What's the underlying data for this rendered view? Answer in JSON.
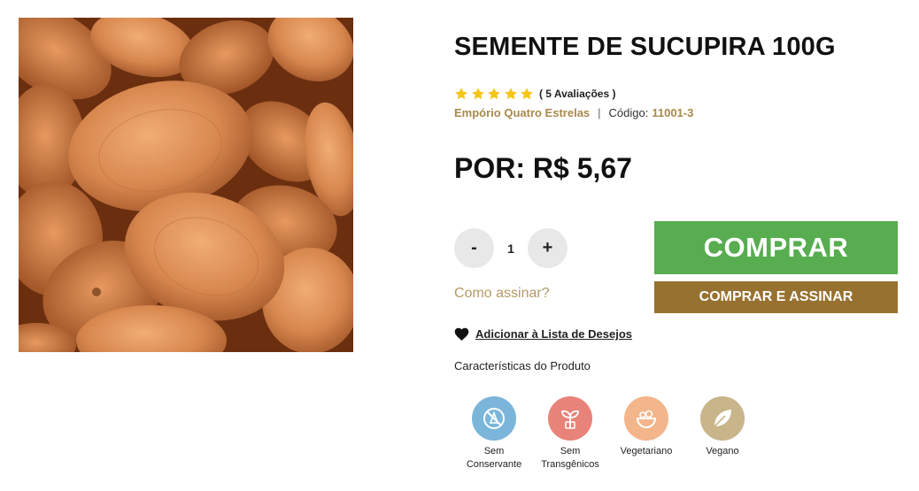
{
  "product": {
    "image_alt": "Semente de Sucupira",
    "title": "SEMENTE DE SUCUPIRA 100G",
    "rating": 5,
    "rating_count_text": "( 5 Avaliações )",
    "brand": "Empório Quatro Estrelas",
    "code_label": "Código:",
    "code_value": "11001-3",
    "price_text": "POR: R$ 5,67"
  },
  "quantity": {
    "decrease_label": "-",
    "value": "1",
    "increase_label": "+"
  },
  "actions": {
    "buy_label": "COMPRAR",
    "subscribe_label": "COMPRAR E ASSINAR",
    "how_to_subscribe": "Como assinar?",
    "wishlist_label": "Adicionar à Lista de Desejos"
  },
  "features": {
    "title": "Características do Produto",
    "items": [
      {
        "label": "Sem\nConservante",
        "icon": "no-preservative-icon",
        "color": "#7bb6da"
      },
      {
        "label": "Sem\nTransgênicos",
        "icon": "sprout-icon",
        "color": "#e8837a"
      },
      {
        "label": "Vegetariano",
        "icon": "salad-bowl-icon",
        "color": "#f3b58a"
      },
      {
        "label": "Vegano",
        "icon": "leaf-icon",
        "color": "#c9b58a"
      }
    ]
  },
  "colors": {
    "star": "#f5c518",
    "brand_gold": "#a8894b",
    "buy_green": "#57ad4f",
    "subscribe_brown": "#977130"
  }
}
